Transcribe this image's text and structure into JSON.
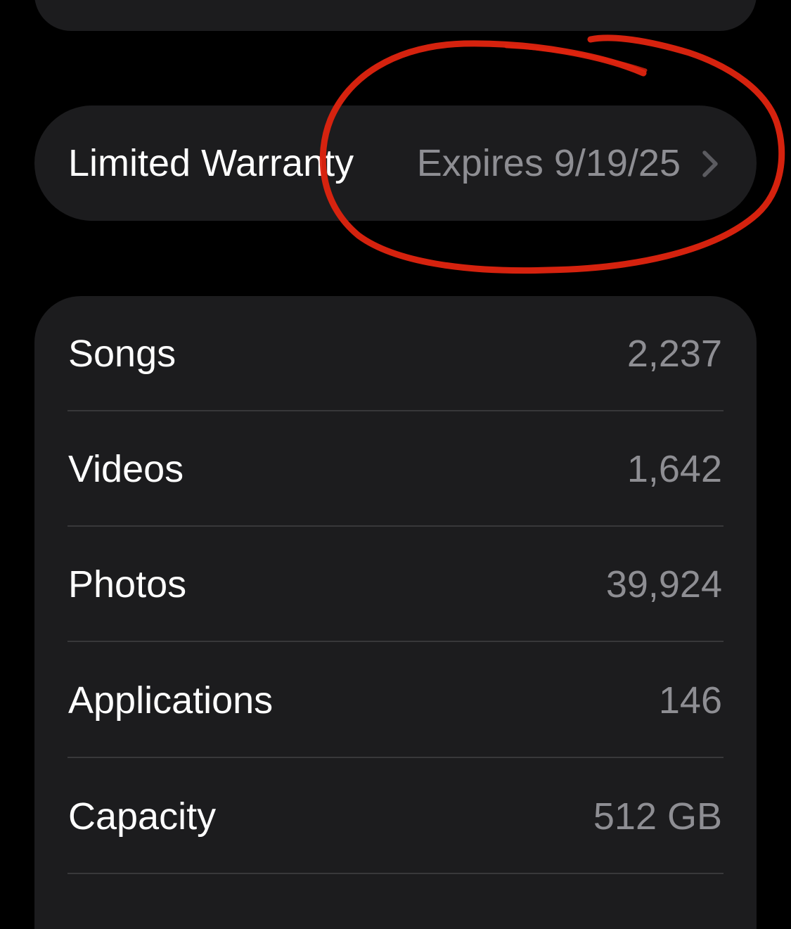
{
  "warranty": {
    "label": "Limited Warranty",
    "value": "Expires 9/19/25",
    "chevron_icon": "chevron-right-icon"
  },
  "stats": [
    {
      "label": "Songs",
      "value": "2,237"
    },
    {
      "label": "Videos",
      "value": "1,642"
    },
    {
      "label": "Photos",
      "value": "39,924"
    },
    {
      "label": "Applications",
      "value": "146"
    },
    {
      "label": "Capacity",
      "value": "512 GB"
    }
  ],
  "colors": {
    "background": "#000000",
    "card": "#1c1c1e",
    "primary_text": "#ffffff",
    "secondary_text": "#8e8e93",
    "divider": "#38383a",
    "annotation": "#e0240f"
  }
}
